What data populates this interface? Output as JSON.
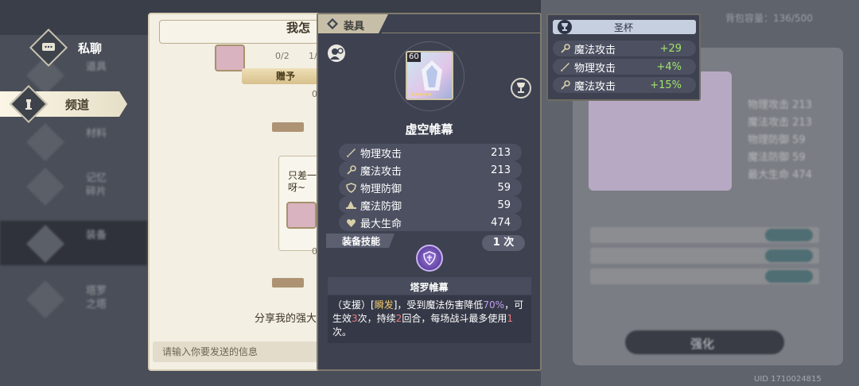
{
  "sidebar": {
    "items": [
      {
        "label": "私聊",
        "icon": "chat-bubble-icon"
      },
      {
        "label": "频道",
        "icon": "tower-icon"
      }
    ],
    "background_items": [
      "道具",
      "材料",
      "记忆碎片",
      "装备",
      "塔罗之塔"
    ]
  },
  "chat": {
    "title": "我怎",
    "progress_a": "0/2",
    "progress_b": "1/",
    "gift_label": "赠予",
    "zero_a": "0",
    "zero_b": "0",
    "message": "只差一呀~",
    "share": "分享我的强大",
    "input_placeholder": "请输入你要发送的信息"
  },
  "equip": {
    "header": "装具",
    "level": "60",
    "name": "虚空帷幕",
    "stats": [
      {
        "icon": "sword-icon",
        "name": "物理攻击",
        "value": "213"
      },
      {
        "icon": "wand-icon",
        "name": "魔法攻击",
        "value": "213"
      },
      {
        "icon": "shield-icon",
        "name": "物理防御",
        "value": "59"
      },
      {
        "icon": "hat-icon",
        "name": "魔法防御",
        "value": "59"
      },
      {
        "icon": "heart-icon",
        "name": "最大生命",
        "value": "474"
      }
    ],
    "skill_header": "装备技能",
    "skill_count": "1 次",
    "skill_name": "塔罗帷幕",
    "skill_desc": {
      "p1": "（支援）[",
      "instant": "瞬发",
      "p2": "]，受到魔法伤害降低",
      "pct": "70%",
      "p3": "，可生效",
      "times": "3",
      "p4": "次，持续",
      "rounds": "2",
      "p5": "回合，每场战斗最多使用",
      "max": "1",
      "p6": "次。"
    }
  },
  "grail": {
    "title": "圣杯",
    "rows": [
      {
        "icon": "wand-icon",
        "name": "魔法攻击",
        "value": "+29"
      },
      {
        "icon": "sword-icon",
        "name": "物理攻击",
        "value": "+4%"
      },
      {
        "icon": "wand-icon",
        "name": "魔法攻击",
        "value": "+15%"
      }
    ]
  },
  "background": {
    "count_text": "背包容量：136/500",
    "stats": [
      "物理攻击 213",
      "魔法攻击 213",
      "物理防御 59",
      "魔法防御 59",
      "最大生命 474"
    ],
    "button": "强化",
    "uid": "UID 1710024815"
  },
  "colors": {
    "panel": "#3d4150",
    "cream": "#f3efe3",
    "bonus_green": "#a3e36b",
    "highlight_yellow": "#f0c86b",
    "highlight_purple": "#c39ff2",
    "highlight_red": "#f37a7a"
  }
}
